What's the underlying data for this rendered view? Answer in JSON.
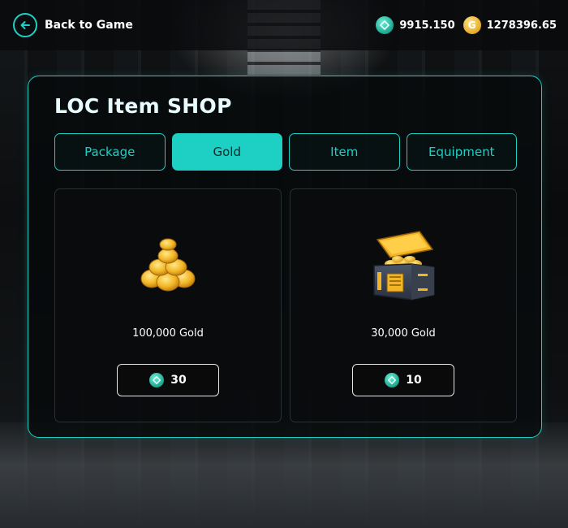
{
  "header": {
    "back_label": "Back to Game",
    "balances": {
      "token": "9915.150",
      "gold": "1278396.65",
      "gold_coin_letter": "G"
    }
  },
  "shop": {
    "title": "LOC Item SHOP",
    "tabs": [
      {
        "label": "Package",
        "active": false
      },
      {
        "label": "Gold",
        "active": true
      },
      {
        "label": "Item",
        "active": false
      },
      {
        "label": "Equipment",
        "active": false
      }
    ],
    "products": [
      {
        "name": "100,000 Gold",
        "price": "30",
        "icon": "gold-coin-pile-icon"
      },
      {
        "name": "30,000 Gold",
        "price": "10",
        "icon": "gold-treasure-chest-icon"
      }
    ]
  },
  "colors": {
    "accent": "#1ecfc4",
    "gold": "#f2b524"
  }
}
